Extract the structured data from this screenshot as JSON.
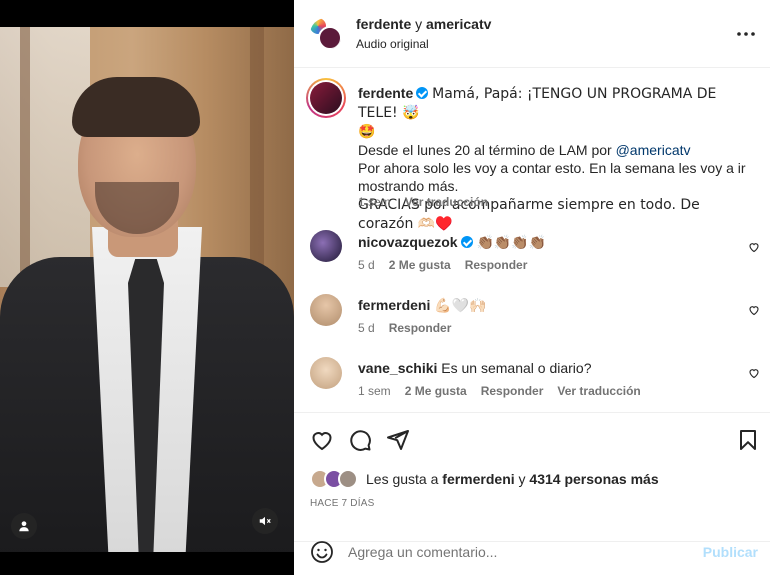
{
  "header": {
    "author_1": "ferdente",
    "connector": "y",
    "author_2": "americatv",
    "audio": "Audio original"
  },
  "caption": {
    "username": "ferdente",
    "line_1": "Mamá, Papá: ¡TENGO UN PROGRAMA DE TELE! 🤯",
    "line_2": "🤩",
    "line_3a": "Desde el lunes 20 al término de LAM por ",
    "mention": "@americatv",
    "line_4": "Por ahora solo les voy a contar esto. En la semana les voy a ir",
    "line_5": "mostrando más.",
    "line_6": "GRACIAS por acompañarme siempre en todo. De corazón 🫶🏻♥️",
    "time": "1 sem",
    "translate": "Ver traducción"
  },
  "comments": [
    {
      "username": "nicovazquezok",
      "text": "👏🏽👏🏽👏🏽👏🏽",
      "time": "5 d",
      "likes": "2 Me gusta",
      "reply": "Responder"
    },
    {
      "username": "fermerdeni",
      "text": "💪🏻🤍🙌🏻",
      "time": "5 d",
      "reply": "Responder"
    },
    {
      "username": "vane_schiki",
      "text": "Es un semanal o diario?",
      "time": "1 sem",
      "likes": "2 Me gusta",
      "reply": "Responder",
      "translate": "Ver traducción"
    }
  ],
  "likes": {
    "prefix": "Les gusta a ",
    "user": "fermerdeni",
    "mid": " y ",
    "count": "4314 personas más"
  },
  "date": "HACE 7 DÍAS",
  "add_comment": {
    "placeholder": "Agrega un comentario...",
    "publish": "Publicar"
  },
  "icons": {
    "more": "more-horizontal-icon",
    "like": "heart-icon",
    "comment": "comment-icon",
    "share": "share-icon",
    "save": "bookmark-icon",
    "emoji": "emoji-icon",
    "user_tag": "user-tag-icon",
    "mute": "muted-speaker-icon"
  },
  "colors": {
    "link": "#00376b",
    "verified": "#0095f6",
    "publish": "#b2dffc"
  }
}
